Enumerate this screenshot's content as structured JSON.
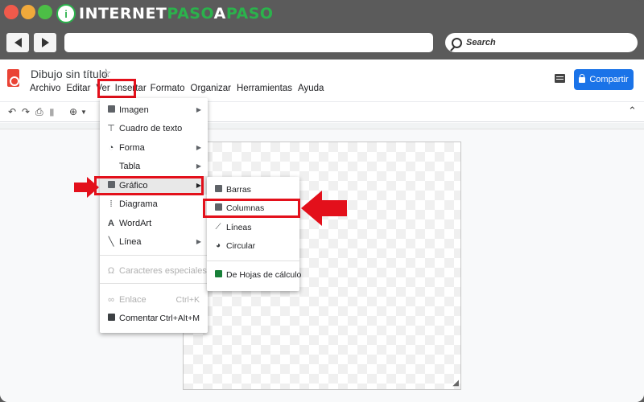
{
  "brand": {
    "logo_mark": "i",
    "logo_text_white_1": "INTERNET",
    "logo_text_green": "PASO",
    "logo_text_white_2": "A",
    "logo_text_green_2": "PASO"
  },
  "browser": {
    "back_icon": "back-arrow-icon",
    "forward_icon": "forward-arrow-icon",
    "search_placeholder": "Search"
  },
  "doc": {
    "title": "Dibujo sin título",
    "star_glyph": "☆",
    "share_label": "Compartir",
    "menus": [
      "Archivo",
      "Editar",
      "Ver",
      "Insertar",
      "Formato",
      "Organizar",
      "Herramientas",
      "Ayuda"
    ]
  },
  "insert_menu": {
    "items": [
      {
        "label": "Imagen",
        "icon": "image-icon",
        "has_submenu": true
      },
      {
        "label": "Cuadro de texto",
        "icon": "textbox-icon",
        "has_submenu": false
      },
      {
        "label": "Forma",
        "icon": "shape-icon",
        "has_submenu": true
      },
      {
        "label": "Tabla",
        "icon": "",
        "has_submenu": true
      },
      {
        "label": "Gráfico",
        "icon": "chart-icon",
        "has_submenu": true
      },
      {
        "label": "Diagrama",
        "icon": "diagram-icon",
        "has_submenu": false
      },
      {
        "label": "WordArt",
        "icon": "wordart-icon",
        "has_submenu": false
      },
      {
        "label": "Línea",
        "icon": "line-icon",
        "has_submenu": true
      },
      {
        "label": "Caracteres especiales",
        "icon": "omega-icon",
        "has_submenu": false,
        "disabled": true
      },
      {
        "label": "Enlace",
        "icon": "link-icon",
        "shortcut": "Ctrl+K",
        "disabled": true
      },
      {
        "label": "Comentar",
        "icon": "comment-icon",
        "shortcut": "Ctrl+Alt+M"
      }
    ]
  },
  "chart_submenu": {
    "items": [
      {
        "label": "Barras",
        "icon": "bar-chart-icon"
      },
      {
        "label": "Columnas",
        "icon": "column-chart-icon"
      },
      {
        "label": "Líneas",
        "icon": "line-chart-icon"
      },
      {
        "label": "Circular",
        "icon": "pie-chart-icon"
      },
      {
        "label": "De Hojas de cálculo",
        "icon": "sheets-icon"
      }
    ]
  },
  "colors": {
    "highlight": "#e3101b",
    "share_button": "#1a73e8",
    "brand_green": "#2bb24c"
  }
}
